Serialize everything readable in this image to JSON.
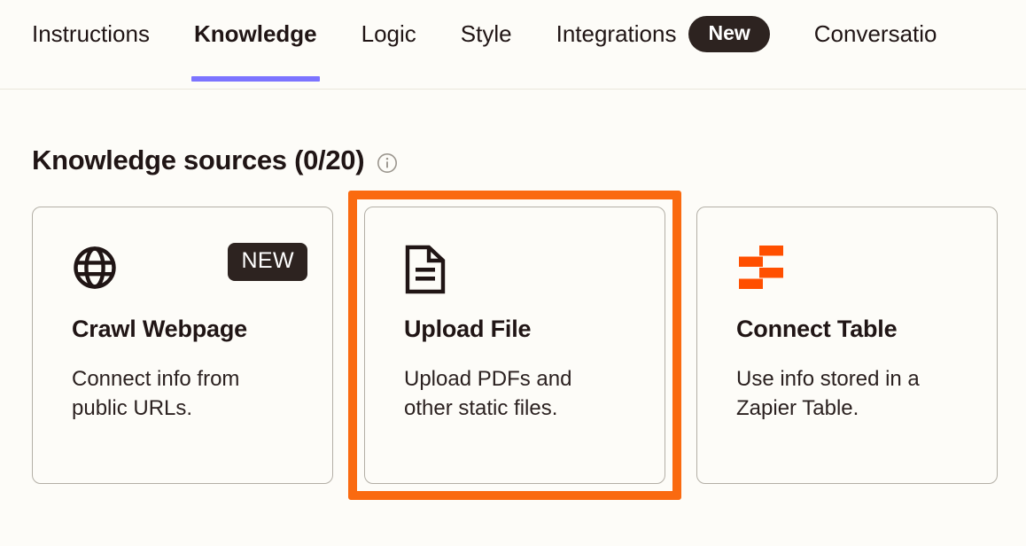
{
  "colors": {
    "page_bg": "#FDFCF8",
    "accent_underline": "#7C74FF",
    "badge_bg": "#2D2320",
    "highlight": "#FA6A10",
    "card_border": "#B3AFA6",
    "zapier_orange": "#FF4F00"
  },
  "tabs": [
    {
      "label": "Instructions",
      "active": false,
      "badge": null
    },
    {
      "label": "Knowledge",
      "active": true,
      "badge": null
    },
    {
      "label": "Logic",
      "active": false,
      "badge": null
    },
    {
      "label": "Style",
      "active": false,
      "badge": null
    },
    {
      "label": "Integrations",
      "active": false,
      "badge": "New"
    },
    {
      "label": "Conversatio",
      "active": false,
      "badge": null
    }
  ],
  "section": {
    "title": "Knowledge sources (0/20)",
    "info_icon": "info-circle-icon"
  },
  "cards": [
    {
      "icon": "globe-icon",
      "badge": "NEW",
      "title": "Crawl Webpage",
      "description": "Connect info from public URLs.",
      "highlighted": false
    },
    {
      "icon": "document-icon",
      "badge": null,
      "title": "Upload File",
      "description": "Upload PDFs and other static files.",
      "highlighted": true
    },
    {
      "icon": "zapier-table-icon",
      "badge": null,
      "title": "Connect Table",
      "description": "Use info stored in a Zapier Table.",
      "highlighted": false
    }
  ]
}
